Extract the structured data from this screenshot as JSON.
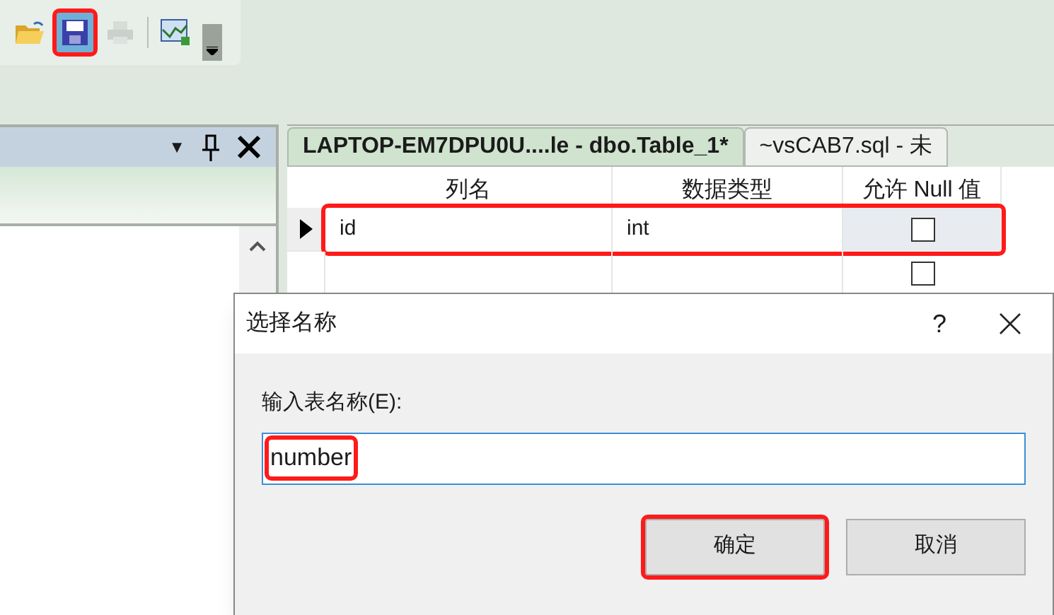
{
  "toolbar": {
    "buttons": [
      {
        "kind": "open",
        "highlighted": false,
        "disabled": false
      },
      {
        "kind": "save",
        "highlighted": true,
        "disabled": false
      },
      {
        "kind": "print",
        "highlighted": false,
        "disabled": true
      },
      {
        "kind": "chart",
        "highlighted": false,
        "disabled": false
      }
    ]
  },
  "left_panel": {
    "header_icons": [
      "▼"
    ]
  },
  "tabs": [
    {
      "label": "LAPTOP-EM7DPU0U....le - dbo.Table_1*",
      "selected": true
    },
    {
      "label": "~vsCAB7.sql - 未",
      "selected": false
    }
  ],
  "table": {
    "columns": [
      "列名",
      "数据类型",
      "允许 Null 值"
    ],
    "rows": [
      {
        "current": true,
        "highlighted": true,
        "cells": [
          "id",
          "int"
        ],
        "allow_null": false
      },
      {
        "current": false,
        "highlighted": false,
        "cells": [
          "",
          ""
        ],
        "allow_null": false
      }
    ]
  },
  "dialog": {
    "title": "选择名称",
    "help": "?",
    "label": "输入表名称(E):",
    "value": "number",
    "value_highlighted": true,
    "buttons": [
      {
        "label": "确定",
        "highlighted": true
      },
      {
        "label": "取消",
        "highlighted": false
      }
    ]
  }
}
